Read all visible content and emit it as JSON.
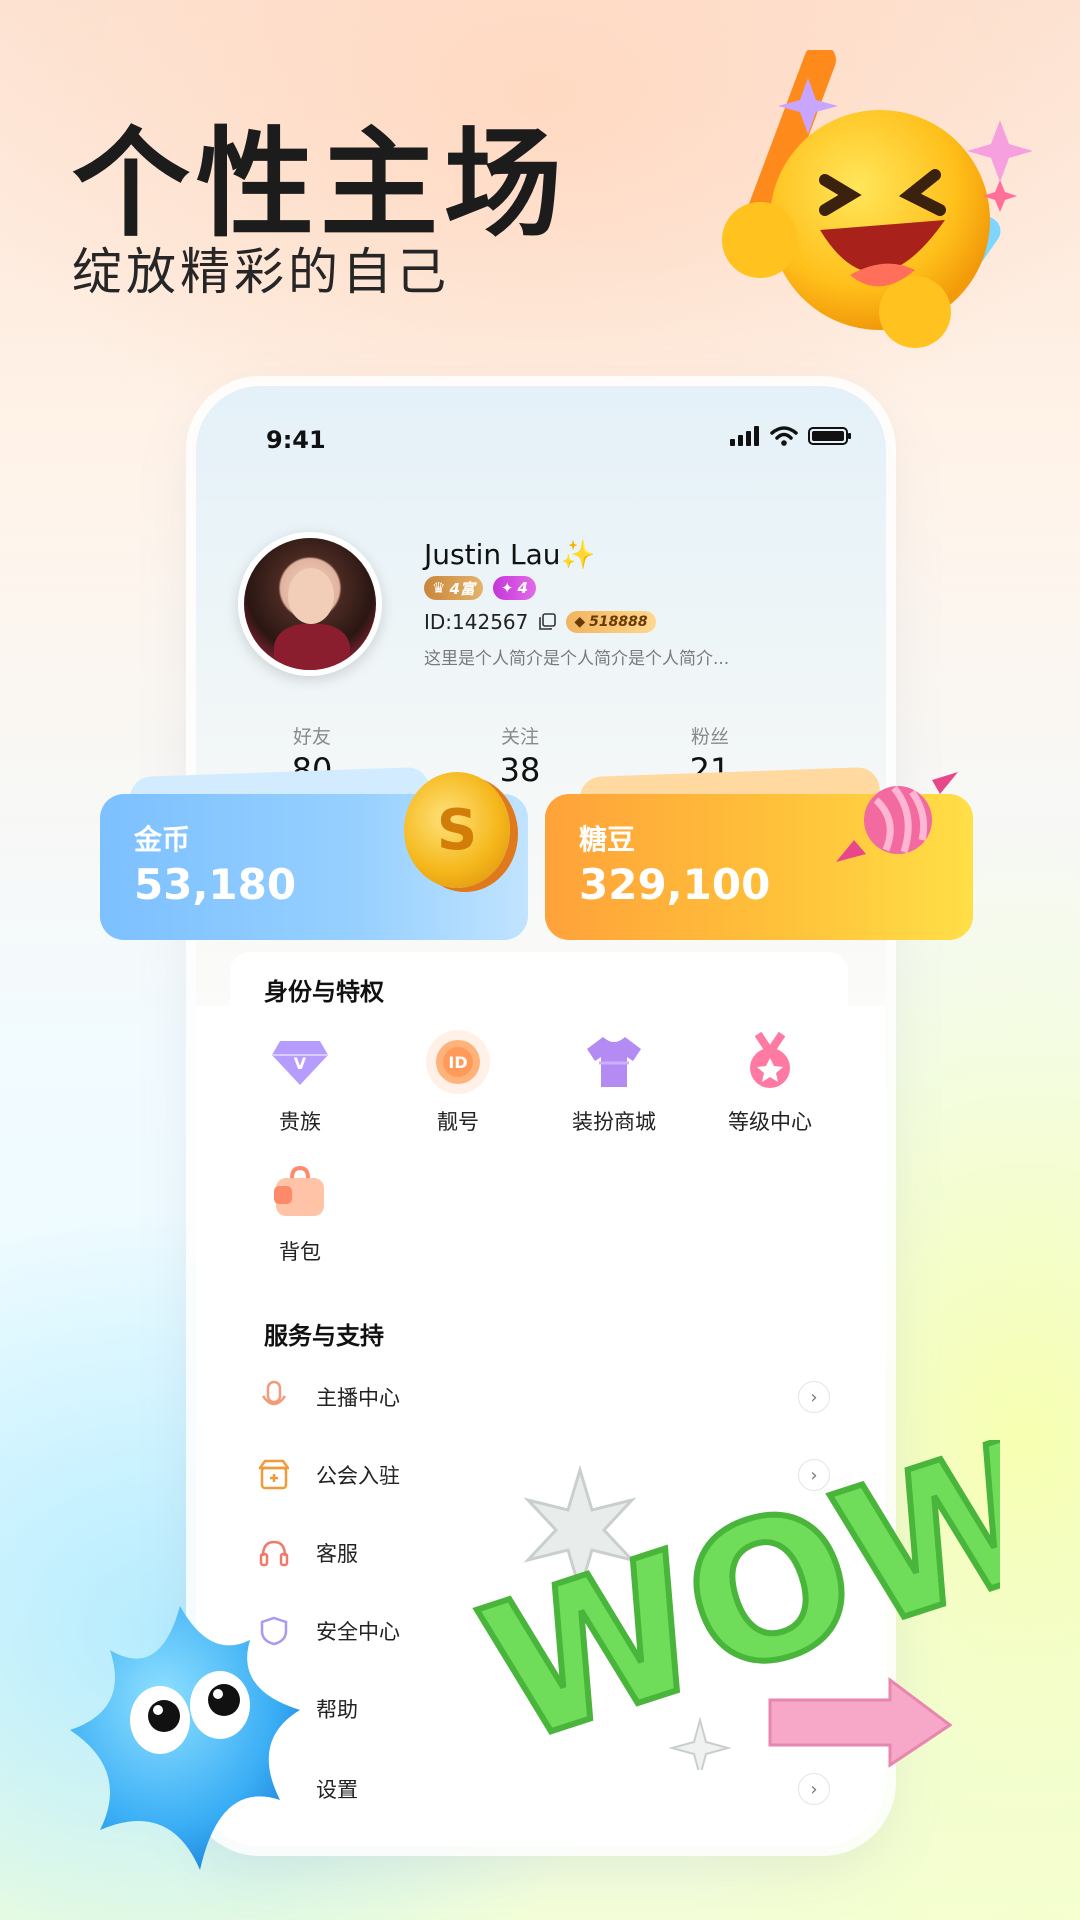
{
  "hero": {
    "title": "个性主场",
    "subtitle": "绽放精彩的自己"
  },
  "status_bar": {
    "time": "9:41"
  },
  "profile": {
    "name": "Justin Lau✨",
    "rich_badge": "4富",
    "level_badge": "4",
    "id_text": "ID:142567",
    "pretty_number": "518888",
    "bio": "这里是个人简介是个人简介是个人简介..."
  },
  "stats": [
    {
      "label": "好友",
      "value": "80"
    },
    {
      "label": "关注",
      "value": "38"
    },
    {
      "label": "粉丝",
      "value": "21"
    }
  ],
  "wallet": {
    "coins": {
      "label": "金币",
      "value": "53,180",
      "icon": "gold-coin-icon"
    },
    "candy": {
      "label": "糖豆",
      "value": "329,100",
      "icon": "candy-icon"
    }
  },
  "privileges": {
    "title": "身份与特权",
    "items": [
      {
        "label": "贵族",
        "icon": "diamond-icon"
      },
      {
        "label": "靓号",
        "icon": "id-badge-icon"
      },
      {
        "label": "装扮商城",
        "icon": "tshirt-icon"
      },
      {
        "label": "等级中心",
        "icon": "medal-icon"
      },
      {
        "label": "背包",
        "icon": "backpack-icon"
      }
    ]
  },
  "services": {
    "title": "服务与支持",
    "items": [
      {
        "label": "主播中心",
        "icon": "microphone-icon"
      },
      {
        "label": "公会入驻",
        "icon": "guild-icon"
      },
      {
        "label": "客服",
        "icon": "headset-icon"
      },
      {
        "label": "安全中心",
        "icon": "shield-icon"
      },
      {
        "label": "帮助",
        "icon": "help-icon"
      },
      {
        "label": "设置",
        "icon": "gear-icon"
      }
    ]
  },
  "decorations": {
    "wow_text": "WOW"
  }
}
